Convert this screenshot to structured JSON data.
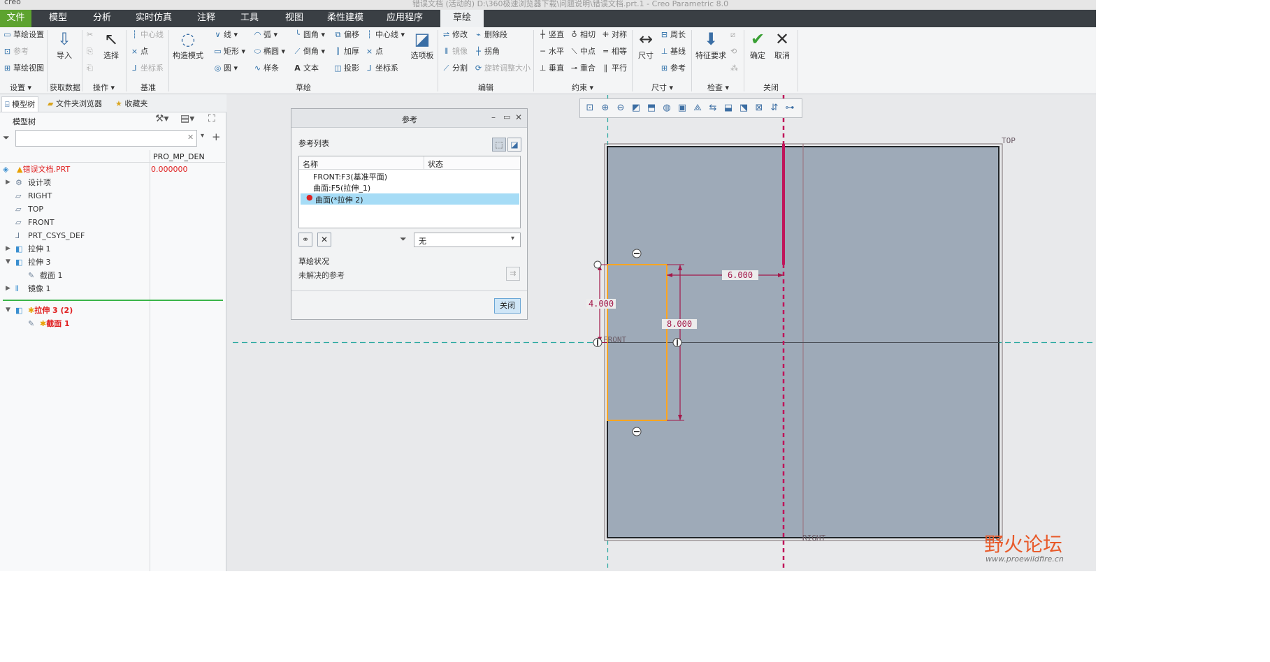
{
  "window": {
    "title": "错误文档 (活动的) D:\\360极速浏览器下载\\问题说明\\错误文档.prt.1 - Creo Parametric 8.0",
    "app_name": "creo"
  },
  "menu_tabs": [
    "文件",
    "模型",
    "分析",
    "实时仿真",
    "注释",
    "工具",
    "视图",
    "柔性建模",
    "应用程序",
    "草绘"
  ],
  "ribbon": {
    "setup": {
      "items": [
        "草绘设置",
        "参考",
        "草绘视图"
      ],
      "label": "设置"
    },
    "get_data": {
      "import": "导入",
      "label": "获取数据"
    },
    "operations": {
      "select": "选择",
      "label": "操作"
    },
    "datum": {
      "items": [
        "中心线",
        "点",
        "坐标系"
      ],
      "label": "基准"
    },
    "sketching": {
      "construction": "构造模式",
      "col1": [
        "线",
        "矩形",
        "圆"
      ],
      "col2": [
        "弧",
        "椭圆",
        "样条"
      ],
      "col3": [
        "圆角",
        "倒角",
        "文本"
      ],
      "col4": [
        "偏移",
        "加厚",
        "投影"
      ],
      "col5": [
        "中心线",
        "点",
        "坐标系"
      ],
      "palette": "选项板",
      "label": "草绘"
    },
    "editing": {
      "col1": [
        "修改",
        "镜像",
        "分割"
      ],
      "col2": [
        "删除段",
        "拐角",
        "旋转调整大小"
      ],
      "label": "编辑"
    },
    "constrain": {
      "col1": [
        "竖直",
        "水平",
        "垂直"
      ],
      "col2": [
        "相切",
        "中点",
        "重合"
      ],
      "col3": [
        "对称",
        "相等",
        "平行"
      ],
      "label": "约束"
    },
    "dimension": {
      "dim": "尺寸",
      "items": [
        "周长",
        "基线",
        "参考"
      ],
      "label": "尺寸"
    },
    "inspect": {
      "feature": "特征要求",
      "label": "检查"
    },
    "close": {
      "ok": "确定",
      "cancel": "取消",
      "label": "关闭"
    }
  },
  "left_panel": {
    "tabs": [
      "模型树",
      "文件夹浏览器",
      "收藏夹"
    ],
    "tree_title": "模型树",
    "column_header": "PRO_MP_DEN",
    "search_placeholder": "",
    "items": [
      {
        "label": "错误文档.PRT",
        "value": "0.000000",
        "icon": "part-icon"
      },
      {
        "label": "设计项",
        "icon": "design-items-icon"
      },
      {
        "label": "RIGHT",
        "icon": "datum-plane-icon"
      },
      {
        "label": "TOP",
        "icon": "datum-plane-icon"
      },
      {
        "label": "FRONT",
        "icon": "datum-plane-icon"
      },
      {
        "label": "PRT_CSYS_DEF",
        "icon": "csys-icon"
      },
      {
        "label": "拉伸 1",
        "icon": "extrude-icon"
      },
      {
        "label": "拉伸 3",
        "icon": "extrude-icon"
      },
      {
        "label": "截面 1",
        "icon": "sketch-icon"
      },
      {
        "label": "镜像 1",
        "icon": "mirror-icon"
      },
      {
        "label": "拉伸 3 (2)",
        "icon": "extrude-icon"
      },
      {
        "label": "截面 1",
        "icon": "sketch-icon"
      }
    ]
  },
  "dialog": {
    "title": "参考",
    "list_title": "参考列表",
    "columns": [
      "名称",
      "状态"
    ],
    "rows": [
      "FRONT:F3(基准平面)",
      "曲面:F5(拉伸_1)",
      "曲面(*拉伸 2)"
    ],
    "filter_value": "无",
    "status_title": "草绘状况",
    "status_text": "未解决的参考",
    "close": "关闭"
  },
  "viewport": {
    "labels": {
      "top": "TOP",
      "front": "FRONT",
      "right": "RIGHT"
    },
    "dims": {
      "d1": "6.000",
      "d2": "4.000",
      "d3": "8.000"
    }
  },
  "watermark": {
    "brand": "野火论坛",
    "url": "www.proewildfire.cn"
  },
  "colors": {
    "menubar": "#3a3f44",
    "file_tab": "#5da32f",
    "surface": "#9eaab8",
    "highlight": "#ffa520",
    "dimension": "#a3184a",
    "ref_line": "#c0145a",
    "selected_row": "#a6dcf6"
  }
}
